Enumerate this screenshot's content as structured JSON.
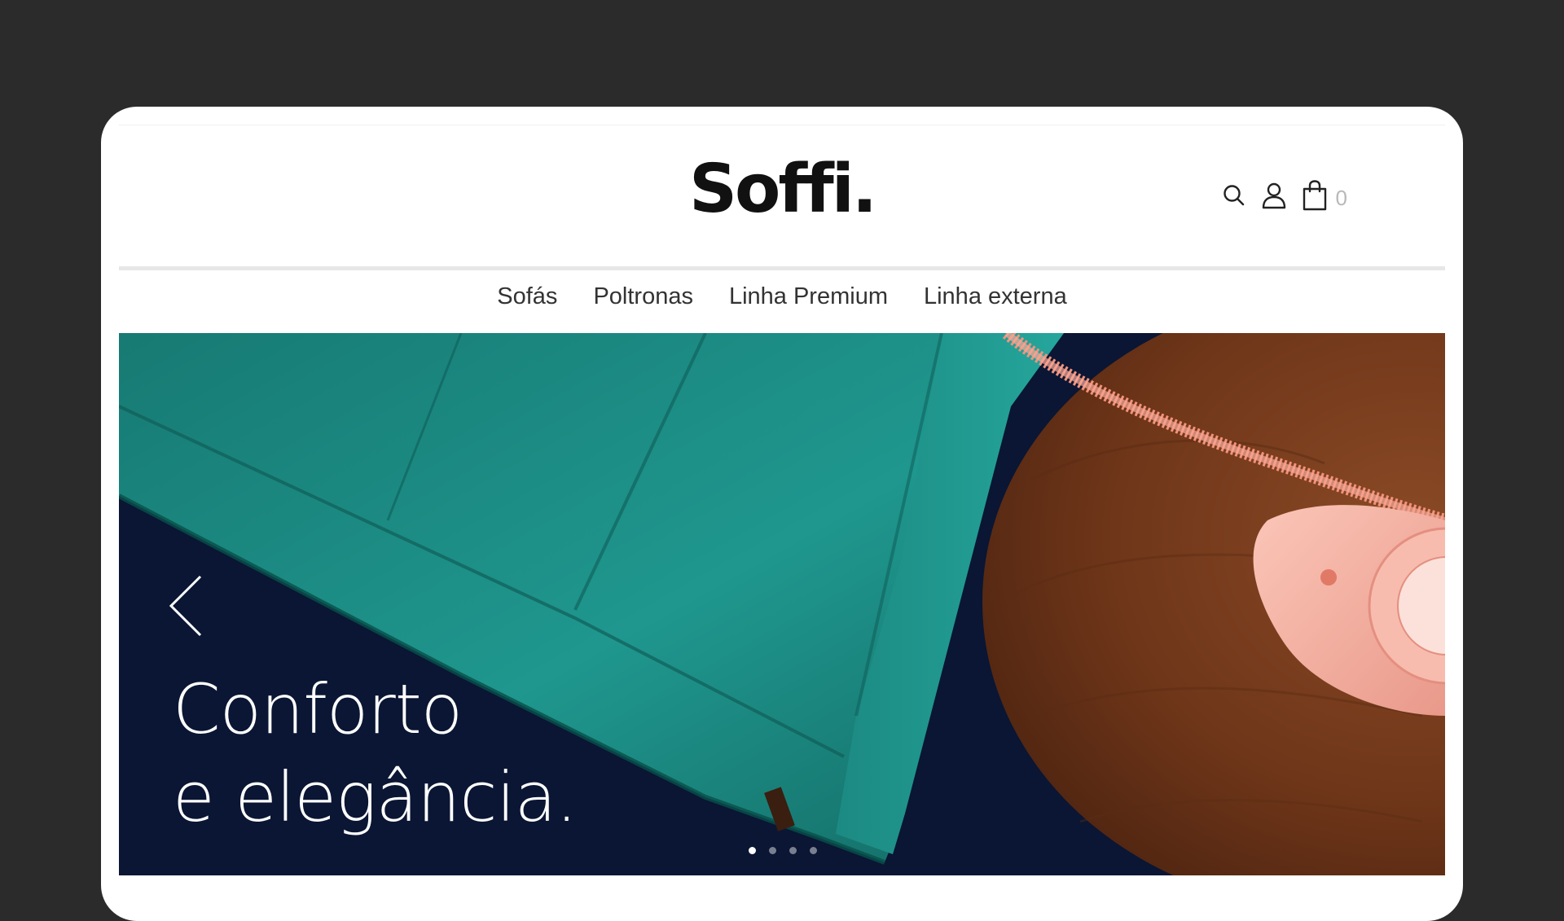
{
  "brand": {
    "logo_text": "Soffi."
  },
  "header": {
    "icons": [
      "search-icon",
      "user-icon",
      "shopping-bag-icon"
    ],
    "cart_count": "0"
  },
  "nav": {
    "items": [
      {
        "label": "Sofás"
      },
      {
        "label": "Poltronas"
      },
      {
        "label": "Linha Premium"
      },
      {
        "label": "Linha externa"
      }
    ]
  },
  "hero": {
    "title_line1": "Conforto",
    "title_line2": "e elegância.",
    "slide_count": 4,
    "active_slide": 1
  },
  "colors": {
    "page_background": "#2b2b2b",
    "hero_background": "#0a1633",
    "sofa_teal": "#1a8f87",
    "table_wood": "#7a3d1e",
    "phone_pink": "#f5b0a2"
  }
}
